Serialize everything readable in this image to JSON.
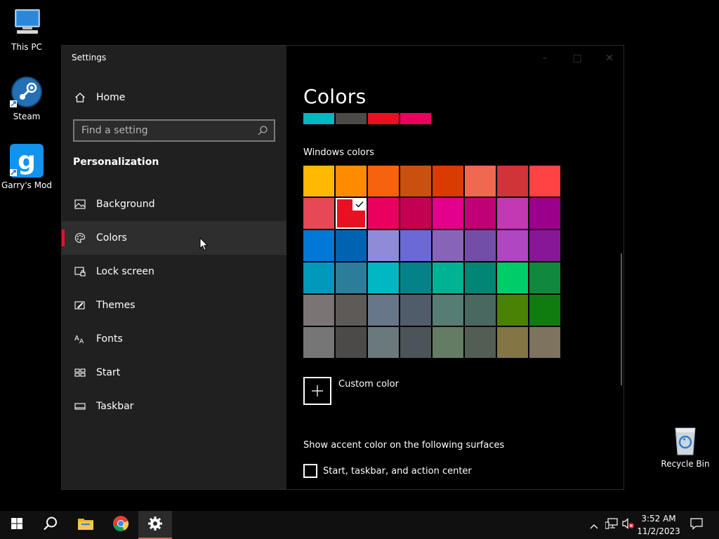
{
  "desktop": {
    "icons": [
      {
        "label": "This PC",
        "icon": "computer-icon"
      },
      {
        "label": "Steam",
        "icon": "steam-icon"
      },
      {
        "label": "Garry's Mod",
        "icon": "garrys-mod-icon"
      },
      {
        "label": "Recycle Bin",
        "icon": "recycle-bin-icon"
      }
    ]
  },
  "window": {
    "title": "Settings",
    "sidebar": {
      "home_label": "Home",
      "search_placeholder": "Find a setting",
      "section_header": "Personalization",
      "items": [
        {
          "label": "Background",
          "icon": "picture-icon"
        },
        {
          "label": "Colors",
          "icon": "palette-icon",
          "selected": true
        },
        {
          "label": "Lock screen",
          "icon": "lock-screen-icon"
        },
        {
          "label": "Themes",
          "icon": "brush-icon"
        },
        {
          "label": "Fonts",
          "icon": "font-icon"
        },
        {
          "label": "Start",
          "icon": "start-tiles-icon"
        },
        {
          "label": "Taskbar",
          "icon": "taskbar-icon"
        }
      ]
    },
    "main": {
      "page_title": "Colors",
      "recent_colors": [
        "#00b7c3",
        "#4c4a48",
        "#e81123",
        "#ea005e"
      ],
      "windows_colors_title": "Windows colors",
      "swatches": [
        [
          "#ffb900",
          "#ff8c00",
          "#f7630c",
          "#ca5010",
          "#da3b01",
          "#ef6950",
          "#d13438",
          "#ff4343"
        ],
        [
          "#e74856",
          "#e81123",
          "#ea005e",
          "#c30052",
          "#e3008c",
          "#bf0077",
          "#c239b3",
          "#9a0089"
        ],
        [
          "#0078d7",
          "#0063b1",
          "#8e8cd8",
          "#6b69d6",
          "#8764b8",
          "#744da9",
          "#b146c2",
          "#881798"
        ],
        [
          "#0099bc",
          "#2d7d9a",
          "#00b7c3",
          "#038387",
          "#00b294",
          "#018574",
          "#00cc6a",
          "#10893e"
        ],
        [
          "#7a7574",
          "#5d5a58",
          "#68768a",
          "#515c6b",
          "#567c73",
          "#486860",
          "#498205",
          "#107c10"
        ],
        [
          "#767676",
          "#4c4a48",
          "#69797e",
          "#4a5459",
          "#647c64",
          "#525e54",
          "#847545",
          "#7e735f"
        ]
      ],
      "selected_swatch": {
        "row": 1,
        "col": 1
      },
      "custom_color_label": "Custom color",
      "accent_surfaces_title": "Show accent color on the following surfaces",
      "checkbox_label": "Start, taskbar, and action center",
      "checkbox_checked": false
    }
  },
  "taskbar": {
    "time": "3:52 AM",
    "date": "11/2/2023"
  },
  "colors": {
    "accent": "#e81123",
    "sidebar_bg": "#202020",
    "taskbar_bg": "#101010"
  }
}
